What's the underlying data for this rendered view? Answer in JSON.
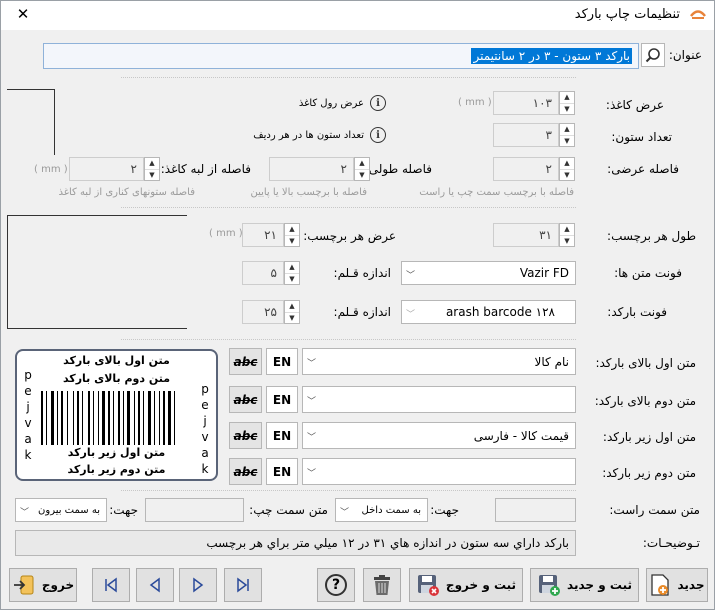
{
  "window": {
    "title": "تنظیمات چاپ بارکد",
    "close_glyph": "✕"
  },
  "title_field": {
    "label": "عنوان:",
    "value": "بارکد ۳ ستون - ۳ در ۲ سانتیمتر"
  },
  "paper": {
    "width_label": "عرض کاغذ:",
    "width_value": "۱۰۳",
    "width_unit": "( mm )",
    "width_hint": "عرض رول کاغذ",
    "columns_label": "تعداد ستون:",
    "columns_value": "۳",
    "columns_hint": "تعداد ستون ها در هر ردیف"
  },
  "gaps": {
    "horizontal_label": "فاصله عرضی:",
    "horizontal_value": "۲",
    "horizontal_hint": "فاصله با برچسب سمت چپ یا راست",
    "vertical_label": "فاصله طولی:",
    "vertical_value": "۲",
    "vertical_hint": "فاصله با برچسب بالا یا پایین",
    "edge_label": "فاصله از لبه کاغذ:",
    "edge_value": "۲",
    "edge_unit": "( mm )",
    "edge_hint": "فاصله ستونهای کناری از لبه کاغذ"
  },
  "label_size": {
    "length_label": "طول هر برچسب:",
    "length_value": "۳۱",
    "width_label": "عرض هر برچسب:",
    "width_value": "۲۱",
    "unit": "( mm )"
  },
  "fonts": {
    "text_font_label": "فونت متن ها:",
    "text_font_value": "Vazir FD",
    "text_pen_label": "اندازه قـلم:",
    "text_pen_value": "۵",
    "barcode_font_label": "فونت بارکد:",
    "barcode_font_value": "arash barcode ۱۲۸",
    "barcode_pen_label": "اندازه قـلم:",
    "barcode_pen_value": "۲۵"
  },
  "text_rows": [
    {
      "label": "متن اول بالای بارکد:",
      "value": "نام کالا",
      "lang": "EN",
      "strike": "abc"
    },
    {
      "label": "متن دوم بالای بارکد:",
      "value": "",
      "lang": "EN",
      "strike": "abc"
    },
    {
      "label": "متن اول زیر بارکد:",
      "value": "قیمت کالا - فارسی",
      "lang": "EN",
      "strike": "abc"
    },
    {
      "label": "متن دوم زیر بارکد:",
      "value": "",
      "lang": "EN",
      "strike": "abc"
    }
  ],
  "preview": {
    "top1": "متن اول بالای بارکد",
    "top2": "متن دوم بالای بارکد",
    "bottom1": "متن اول زیر بارکد",
    "bottom2": "متن دوم زیر بارکد",
    "side_left": [
      "p",
      "e",
      "j",
      "v",
      "a",
      "k"
    ],
    "side_right": [
      "p",
      "e",
      "j",
      "v",
      "a",
      "k"
    ]
  },
  "side_text": {
    "right_label": "متن سمت راست:",
    "right_dir_label": "جهت:",
    "right_dir_value": "به سمت داخل",
    "left_label": "متن سمت چپ:",
    "left_dir_label": "جهت:",
    "left_dir_value": "به سمت بیرون"
  },
  "description": {
    "label": "تـوضیحـات:",
    "value": "بارکد داراي سه ستون در اندازه هاي ۳۱ در ۱۲ ميلي متر براي هر برچسب"
  },
  "buttons": {
    "new": "جدید",
    "save_new": "ثبت و جدید",
    "save_exit": "ثبت و خروج",
    "exit": "خروج",
    "help": "?"
  }
}
